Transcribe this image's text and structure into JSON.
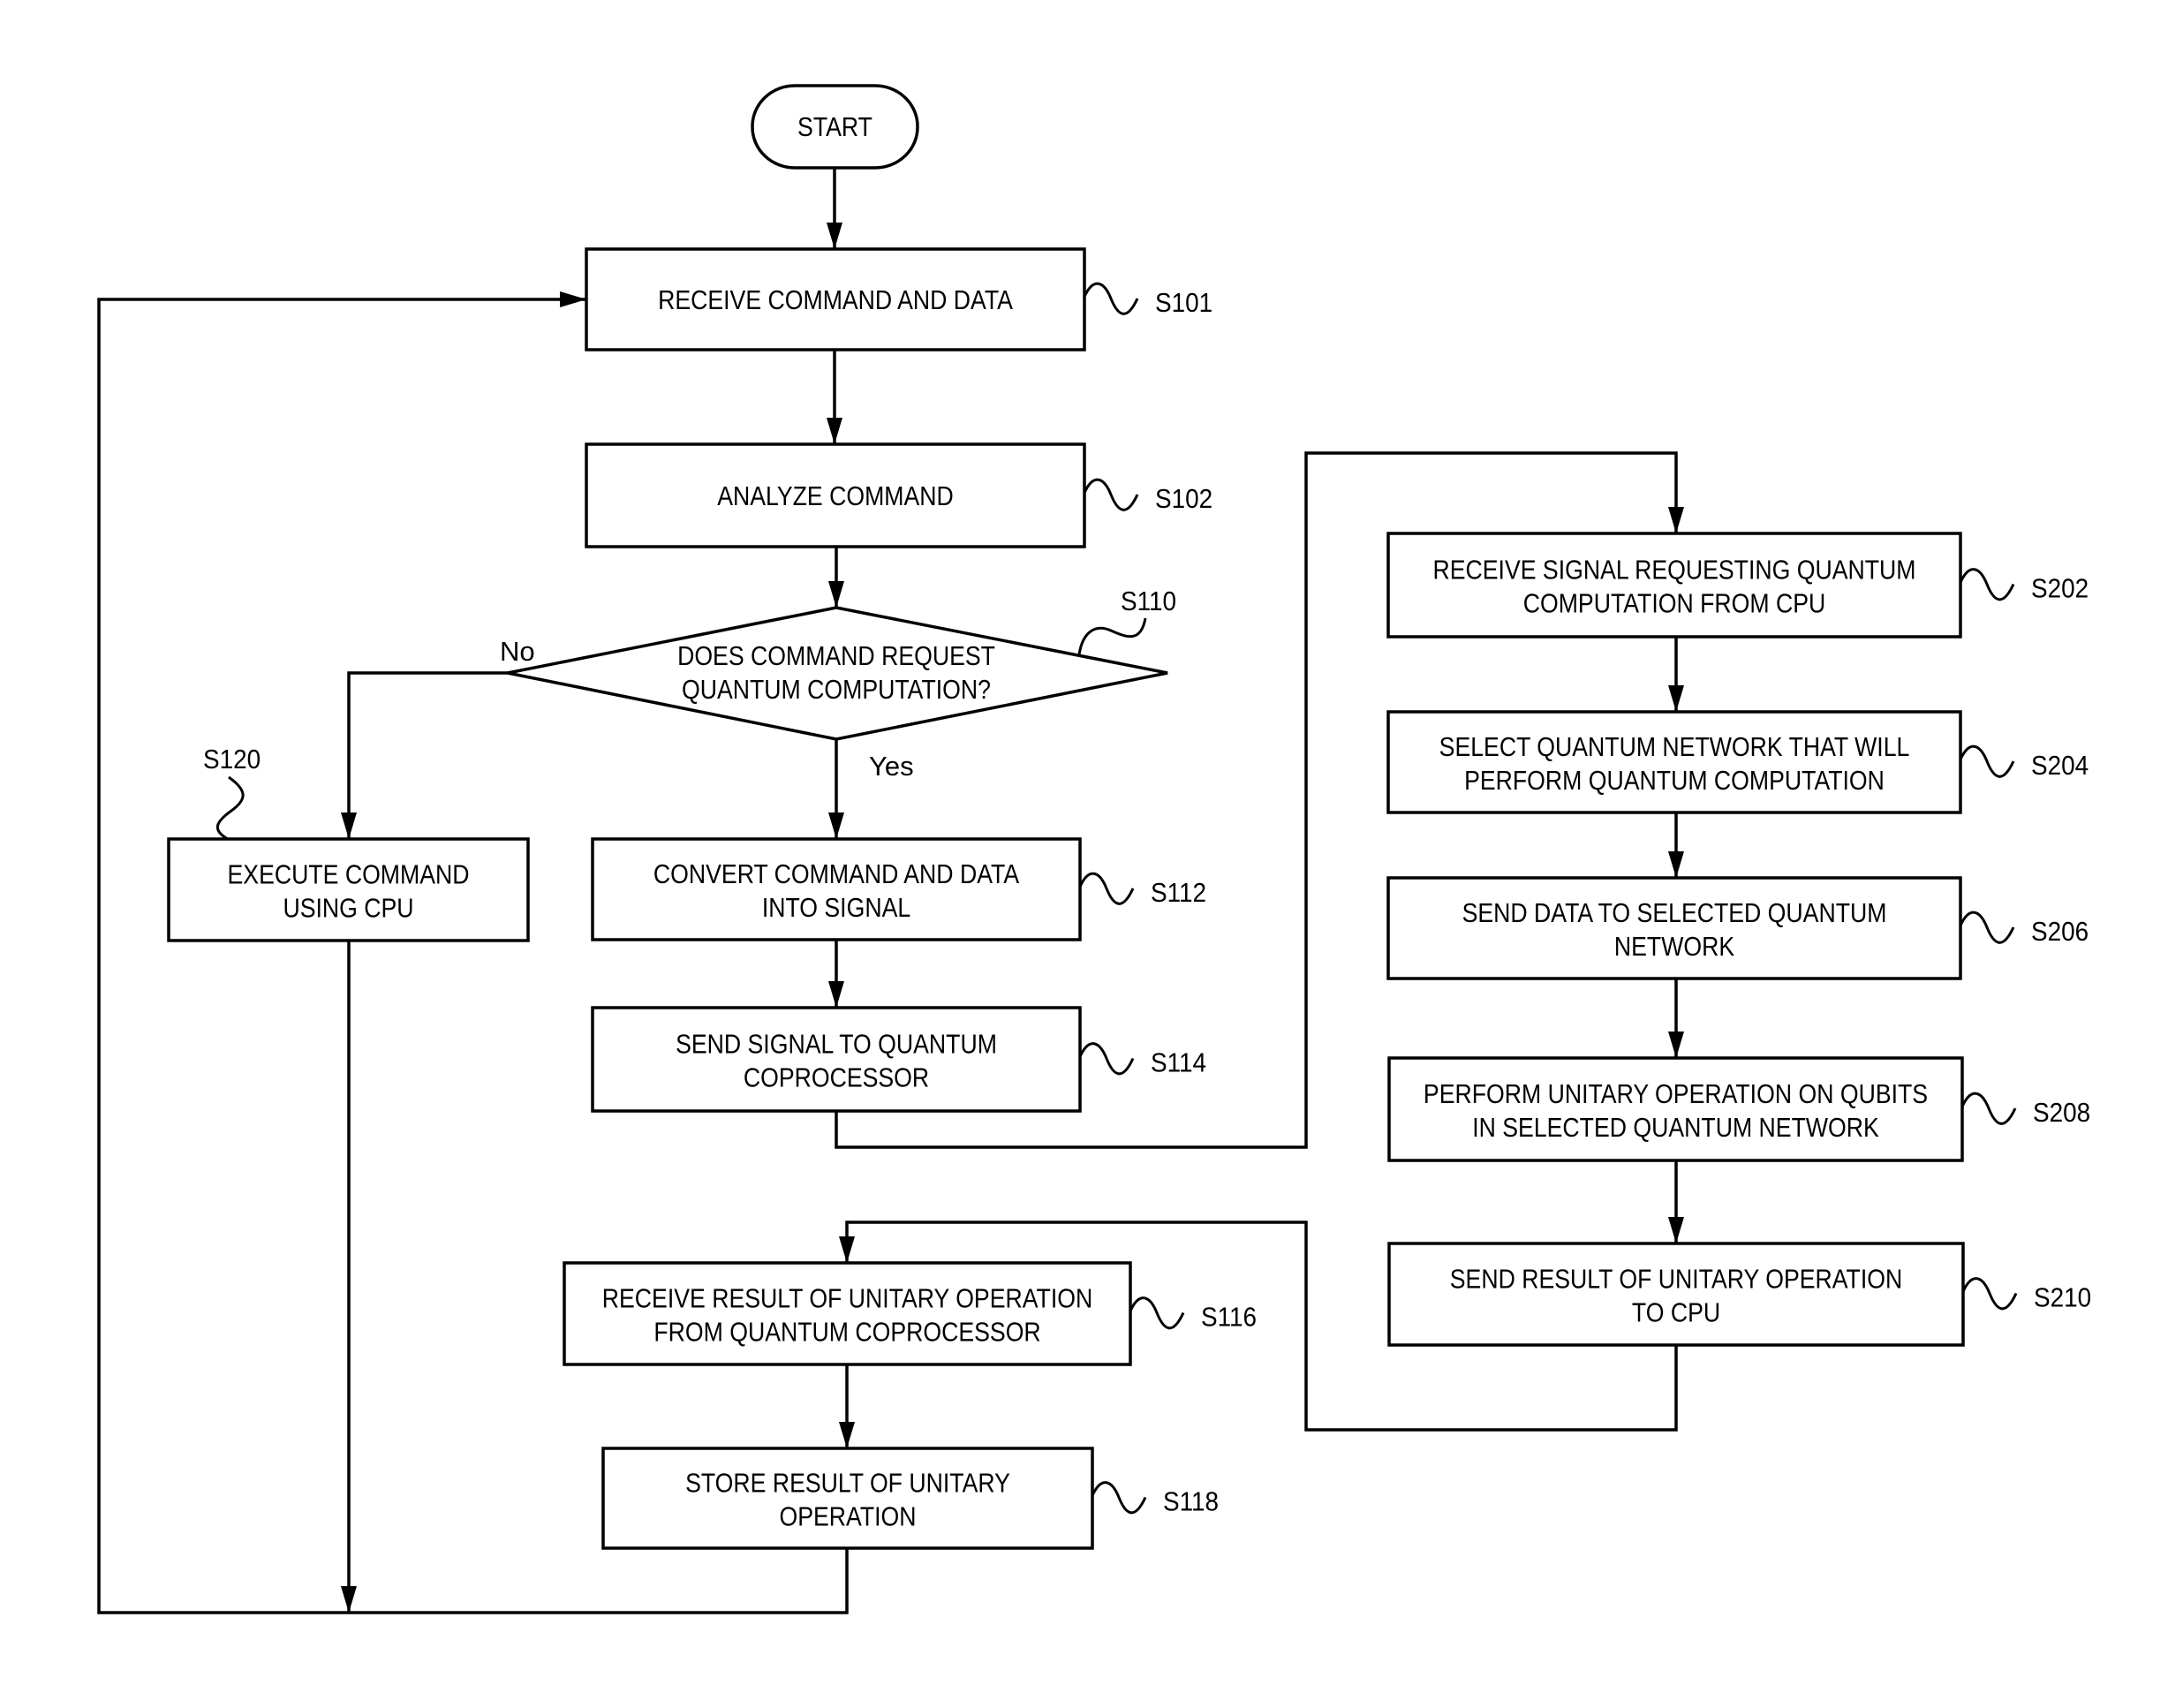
{
  "diagram": {
    "type": "flowchart",
    "colors": {
      "stroke": "#000000",
      "background": "#ffffff"
    },
    "start": {
      "id": "start",
      "label": "START"
    },
    "nodes": [
      {
        "id": "S101",
        "shape": "process",
        "lines": [
          "RECEIVE COMMAND AND DATA"
        ],
        "step": "S101"
      },
      {
        "id": "S102",
        "shape": "process",
        "lines": [
          "ANALYZE COMMAND"
        ],
        "step": "S102"
      },
      {
        "id": "S110",
        "shape": "decision",
        "lines": [
          "DOES COMMAND REQUEST",
          "QUANTUM COMPUTATION?"
        ],
        "step": "S110"
      },
      {
        "id": "S120",
        "shape": "process",
        "lines": [
          "EXECUTE COMMAND",
          "USING CPU"
        ],
        "step": "S120"
      },
      {
        "id": "S112",
        "shape": "process",
        "lines": [
          "CONVERT COMMAND AND DATA",
          "INTO SIGNAL"
        ],
        "step": "S112"
      },
      {
        "id": "S114",
        "shape": "process",
        "lines": [
          "SEND SIGNAL TO QUANTUM",
          "COPROCESSOR"
        ],
        "step": "S114"
      },
      {
        "id": "S202",
        "shape": "process",
        "lines": [
          "RECEIVE SIGNAL REQUESTING QUANTUM",
          "COMPUTATION FROM CPU"
        ],
        "step": "S202"
      },
      {
        "id": "S204",
        "shape": "process",
        "lines": [
          "SELECT QUANTUM NETWORK THAT WILL",
          "PERFORM QUANTUM COMPUTATION"
        ],
        "step": "S204"
      },
      {
        "id": "S206",
        "shape": "process",
        "lines": [
          "SEND DATA TO SELECTED QUANTUM",
          "NETWORK"
        ],
        "step": "S206"
      },
      {
        "id": "S208",
        "shape": "process",
        "lines": [
          "PERFORM UNITARY OPERATION ON QUBITS",
          "IN SELECTED QUANTUM NETWORK"
        ],
        "step": "S208"
      },
      {
        "id": "S210",
        "shape": "process",
        "lines": [
          "SEND RESULT OF UNITARY OPERATION",
          "TO CPU"
        ],
        "step": "S210"
      },
      {
        "id": "S116",
        "shape": "process",
        "lines": [
          "RECEIVE RESULT OF UNITARY OPERATION",
          "FROM QUANTUM COPROCESSOR"
        ],
        "step": "S116"
      },
      {
        "id": "S118",
        "shape": "process",
        "lines": [
          "STORE RESULT OF UNITARY",
          "OPERATION"
        ],
        "step": "S118"
      }
    ],
    "edges": [
      {
        "from": "start",
        "to": "S101"
      },
      {
        "from": "S101",
        "to": "S102"
      },
      {
        "from": "S102",
        "to": "S110"
      },
      {
        "from": "S110",
        "to": "S120",
        "label": "No"
      },
      {
        "from": "S110",
        "to": "S112",
        "label": "Yes"
      },
      {
        "from": "S112",
        "to": "S114"
      },
      {
        "from": "S114",
        "to": "S202"
      },
      {
        "from": "S202",
        "to": "S204"
      },
      {
        "from": "S204",
        "to": "S206"
      },
      {
        "from": "S206",
        "to": "S208"
      },
      {
        "from": "S208",
        "to": "S210"
      },
      {
        "from": "S210",
        "to": "S116"
      },
      {
        "from": "S116",
        "to": "S118"
      },
      {
        "from": "S118",
        "to": "S101"
      },
      {
        "from": "S120",
        "to": "S101"
      }
    ],
    "branch_labels": {
      "no": "No",
      "yes": "Yes"
    }
  }
}
